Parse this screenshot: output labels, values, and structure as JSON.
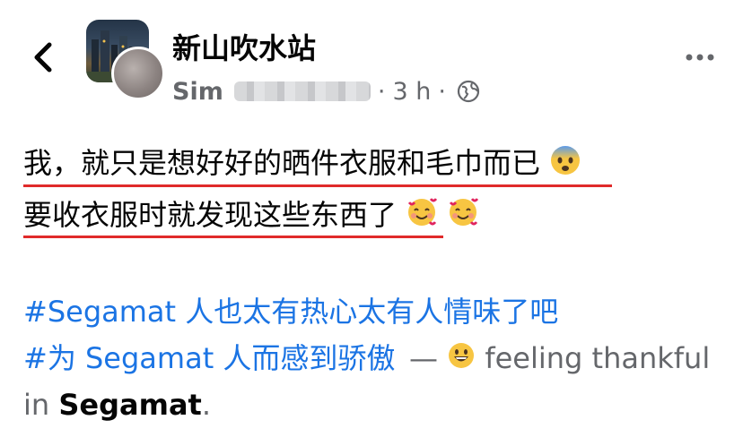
{
  "header": {
    "group_name": "新山吹水站",
    "author_name": "Sim",
    "separator": "·",
    "time": "3 h"
  },
  "post": {
    "line1": "我，就只是想好好的晒件衣服和毛巾而已",
    "line2": "要收衣服时就发现这些东西了",
    "hashtag1": "#Segamat 人也太有热心太有人情味了吧",
    "hashtag2": "#为 Segamat 人而感到骄傲",
    "dash": "—",
    "feeling": "feeling thankful",
    "in_label": "in",
    "location": "Segamat",
    "period": "."
  },
  "icons": {
    "back": "chevron-left-icon",
    "privacy": "globe-icon",
    "more": "more-horizontal-icon",
    "emoji1": "anxious-face-emoji",
    "emoji2": "smiling-face-with-hearts-emoji",
    "feeling_emoji": "grinning-face-emoji"
  },
  "colors": {
    "link": "#1b74e4",
    "secondary": "#65676b",
    "underline": "#e02a2a"
  }
}
